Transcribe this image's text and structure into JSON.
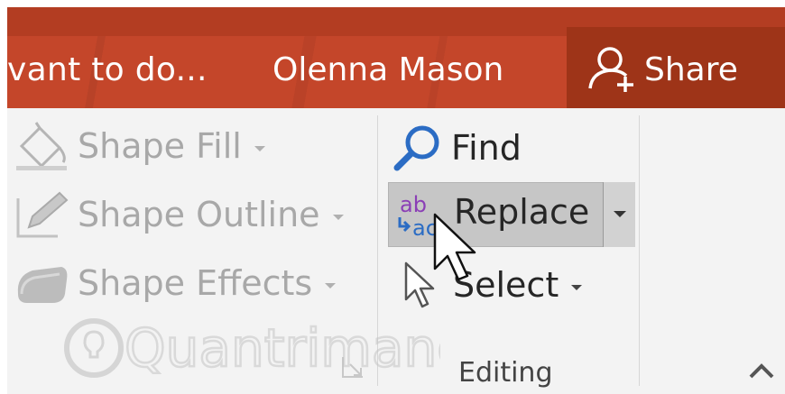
{
  "titlebar": {
    "tell_me_text": "vant to do...",
    "user_name": "Olenna Mason",
    "share_label": "Share"
  },
  "ribbon": {
    "drawing": {
      "shape_fill": "Shape Fill",
      "shape_outline": "Shape Outline",
      "shape_effects": "Shape Effects"
    },
    "editing": {
      "find": "Find",
      "replace": "Replace",
      "select": "Select",
      "group_label": "Editing"
    }
  },
  "watermark": "Quantrimang",
  "colors": {
    "titlebar": "#c4462a",
    "share_bg": "#9e3418",
    "ribbon_bg": "#f3f3f3",
    "hover_bg": "#c6c6c6",
    "find_icon": "#2b6cc4",
    "replace_purple": "#8b3fb6",
    "replace_blue": "#2b6cc4"
  },
  "icons": {
    "share": "person-plus-icon",
    "shape_fill": "paint-bucket-icon",
    "shape_outline": "pencil-icon",
    "shape_effects": "eraser-icon",
    "find": "magnifier-icon",
    "replace": "replace-ab-ac-icon",
    "select": "arrow-cursor-icon",
    "collapse": "chevron-up-icon",
    "launcher": "dialog-launcher-icon",
    "cursor": "mouse-pointer-icon"
  }
}
